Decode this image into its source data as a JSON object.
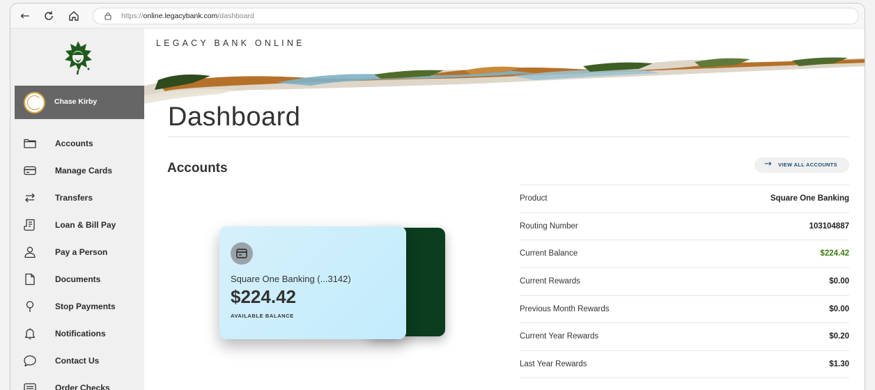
{
  "browser": {
    "url_scheme": "https://",
    "url_host": "online.legacybank.com",
    "url_path": "/dashboard"
  },
  "brand": {
    "title": "LEGACY BANK ONLINE",
    "accent_color": "#0b3d1f"
  },
  "user": {
    "name": "Chase Kirby"
  },
  "sidebar": {
    "items": [
      {
        "label": "Accounts",
        "icon": "folder-icon"
      },
      {
        "label": "Manage Cards",
        "icon": "credit-card-icon"
      },
      {
        "label": "Transfers",
        "icon": "transfer-arrows-icon"
      },
      {
        "label": "Loan & Bill Pay",
        "icon": "receipt-icon"
      },
      {
        "label": "Pay a Person",
        "icon": "person-icon"
      },
      {
        "label": "Documents",
        "icon": "document-icon"
      },
      {
        "label": "Stop Payments",
        "icon": "location-pin-icon"
      },
      {
        "label": "Notifications",
        "icon": "bell-icon"
      },
      {
        "label": "Contact Us",
        "icon": "chat-bubble-icon"
      },
      {
        "label": "Order Checks",
        "icon": "checkbook-icon"
      }
    ]
  },
  "main": {
    "page_title": "Dashboard",
    "section_title": "Accounts",
    "view_all_label": "VIEW ALL ACCOUNTS"
  },
  "account_card": {
    "name": "Square One Banking (...3142)",
    "amount": "$224.42",
    "sub_label": "AVAILABLE BALANCE"
  },
  "details": [
    {
      "label": "Product",
      "value": "Square One Banking"
    },
    {
      "label": "Routing Number",
      "value": "103104887"
    },
    {
      "label": "Current Balance",
      "value": "$224.42",
      "highlight": true
    },
    {
      "label": "Current Rewards",
      "value": "$0.00"
    },
    {
      "label": "Previous Month Rewards",
      "value": "$0.00"
    },
    {
      "label": "Current Year Rewards",
      "value": "$0.20"
    },
    {
      "label": "Last Year Rewards",
      "value": "$1.30"
    }
  ]
}
